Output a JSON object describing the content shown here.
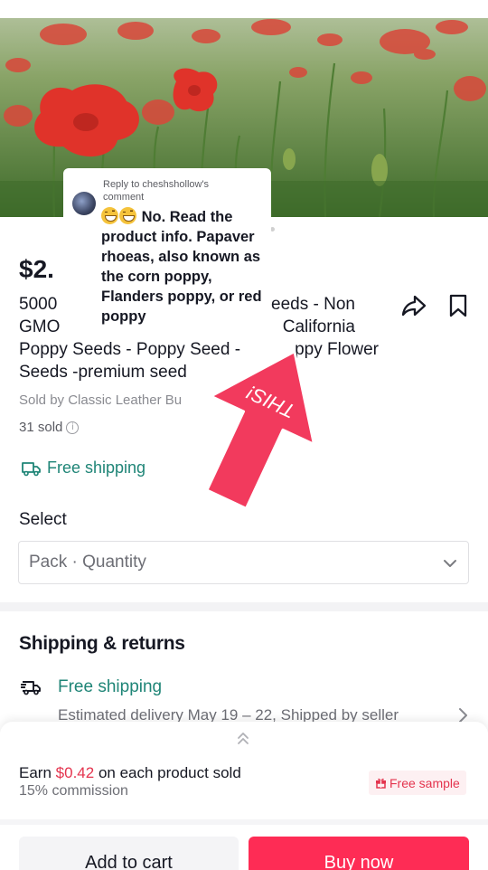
{
  "product": {
    "price": "$2.",
    "title_lines": [
      "5000 ... eeds - Non",
      "GMO ... California",
      "Poppy Seeds - Poppy Seed - ... ppy Flower",
      "Seeds -premium seed"
    ],
    "title_line1_left": "5000",
    "title_line1_right": "eeds - Non",
    "title_line2_left": "GMO",
    "title_line2_right": "California",
    "title_line3_left": "Poppy Seeds - Poppy Seed -",
    "title_line3_right": "ppy Flower",
    "title_line4": "Seeds -premium seed",
    "sold_by": "Sold by Classic Leather Bu",
    "sold_count": "31 sold",
    "free_shipping": "Free shipping"
  },
  "select": {
    "label": "Select",
    "placeholder": "Pack · Quantity"
  },
  "shipping_returns": {
    "title": "Shipping & returns",
    "free_shipping": "Free shipping",
    "estimate": "Estimated delivery May 19 – 22, Shipped by seller"
  },
  "affiliate": {
    "earn_prefix": "Earn",
    "earn_amount": "$0.42",
    "earn_suffix": "on each product sold",
    "commission": "15% commission",
    "free_sample": "Free sample"
  },
  "actions": {
    "add_to_cart": "Add to cart",
    "buy_now": "Buy now"
  },
  "comment": {
    "reply_to": "Reply to cheshshollow's comment",
    "text": "No. Read the product info. Papaver rhoeas, also known as the corn poppy, Flanders poppy, or red poppy"
  },
  "sticker": {
    "text": "THIS!"
  },
  "colors": {
    "accent_teal": "#1f8577",
    "buy_red": "#fe2c55",
    "earn_red": "#e4344e",
    "sticker_pink": "#f23a5d"
  }
}
